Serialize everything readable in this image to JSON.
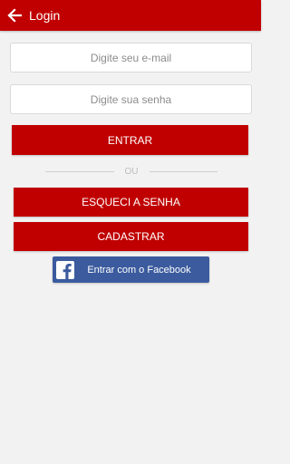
{
  "header": {
    "title": "Login",
    "back_icon": "arrow-left-icon"
  },
  "form": {
    "email_placeholder": "Digite seu e-mail",
    "password_placeholder": "Digite sua senha",
    "email_value": "",
    "password_value": ""
  },
  "buttons": {
    "login": "ENTRAR",
    "separator": "OU",
    "forgot_password": "ESQUECI A SENHA",
    "register": "CADASTRAR",
    "facebook": "Entrar com o Facebook",
    "facebook_icon": "facebook-icon"
  },
  "colors": {
    "accent": "#c00000",
    "facebook": "#3b5b9e",
    "background": "#f2f2f2"
  }
}
